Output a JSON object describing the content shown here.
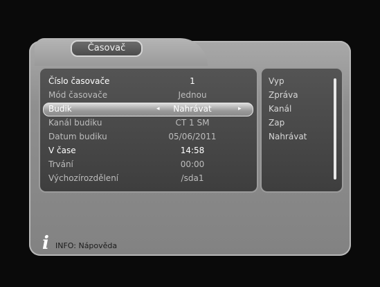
{
  "window": {
    "title": "Časovač"
  },
  "form": {
    "rows": [
      {
        "label": "Číslo časovače",
        "value": "1"
      },
      {
        "label": "Mód časovače",
        "value": "Jednou"
      },
      {
        "label": "Budik",
        "value": "Nahrávat"
      },
      {
        "label": "Kanál budiku",
        "value": "CT 1 SM"
      },
      {
        "label": "Datum budiku",
        "value": "05/06/2011"
      },
      {
        "label": "V čase",
        "value": "14:58"
      },
      {
        "label": "Trvání",
        "value": "00:00"
      },
      {
        "label": "Výchozírozdělení",
        "value": "/sda1"
      }
    ],
    "arrows": {
      "left": "◂",
      "right": "▸"
    }
  },
  "options": {
    "items": [
      "Vyp",
      "Zpráva",
      "Kanál",
      "Zap",
      "Nahrávat"
    ]
  },
  "info": {
    "icon": "i",
    "text": "INFO: Nápověda"
  },
  "icons": {
    "info": "info-icon",
    "left_arrow": "chevron-left-icon",
    "right_arrow": "chevron-right-icon"
  }
}
